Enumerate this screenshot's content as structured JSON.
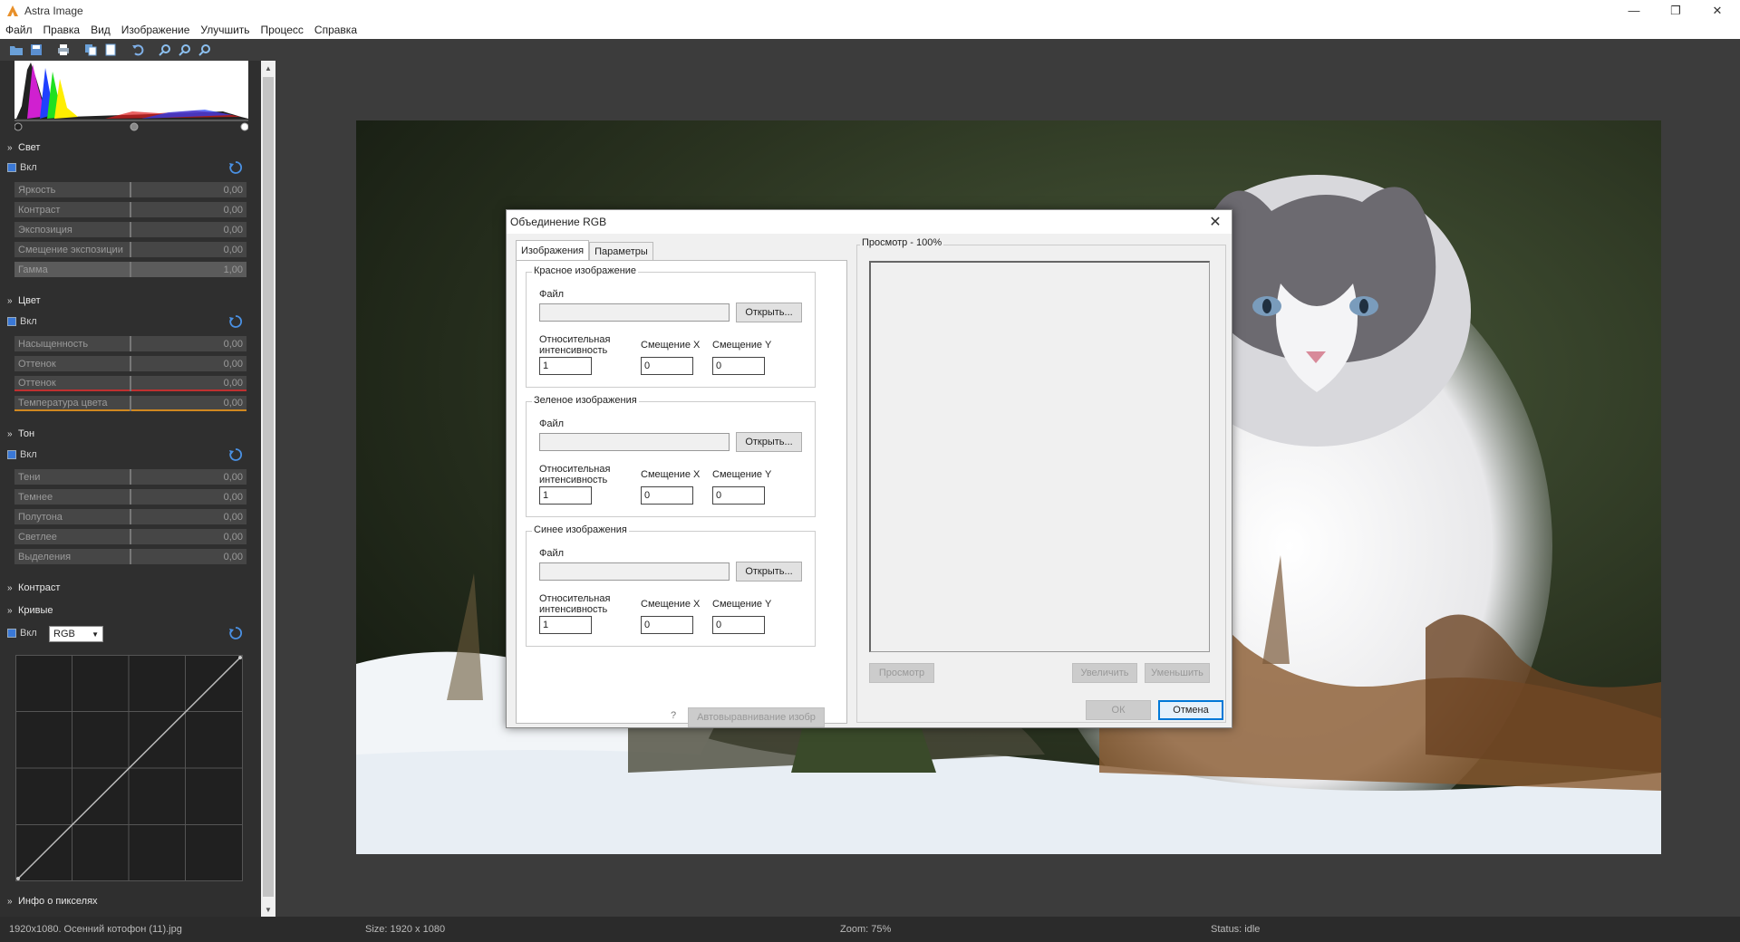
{
  "app": {
    "title": "Astra Image"
  },
  "window": {
    "minimize": "—",
    "restore": "❐",
    "close": "✕"
  },
  "menu": [
    "Файл",
    "Правка",
    "Вид",
    "Изображение",
    "Улучшить",
    "Процесс",
    "Справка"
  ],
  "panel": {
    "light": {
      "title": "Свет",
      "enable": "Вкл",
      "sliders": [
        {
          "label": "Яркость",
          "value": "0,00"
        },
        {
          "label": "Контраст",
          "value": "0,00"
        },
        {
          "label": "Экспозиция",
          "value": "0,00"
        },
        {
          "label": "Смещение экспозиции",
          "value": "0,00"
        },
        {
          "label": "Гамма",
          "value": "1,00"
        }
      ]
    },
    "color": {
      "title": "Цвет",
      "enable": "Вкл",
      "sliders": [
        {
          "label": "Насыщенность",
          "value": "0,00"
        },
        {
          "label": "Оттенок",
          "value": "0,00"
        },
        {
          "label": "Оттенок",
          "value": "0,00"
        },
        {
          "label": "Температура цвета",
          "value": "0,00"
        }
      ]
    },
    "tone": {
      "title": "Тон",
      "enable": "Вкл",
      "sliders": [
        {
          "label": "Тени",
          "value": "0,00"
        },
        {
          "label": "Темнее",
          "value": "0,00"
        },
        {
          "label": "Полутона",
          "value": "0,00"
        },
        {
          "label": "Светлее",
          "value": "0,00"
        },
        {
          "label": "Выделения",
          "value": "0,00"
        }
      ]
    },
    "contrast": {
      "title": "Контраст"
    },
    "curves": {
      "title": "Кривые",
      "enable": "Вкл",
      "channel": "RGB"
    },
    "pixelinfo": {
      "title": "Инфо о пикселях"
    }
  },
  "dialog": {
    "title": "Объединение RGB",
    "tabs": [
      "Изображения",
      "Параметры"
    ],
    "groups": [
      {
        "title": "Красное изображение",
        "file_label": "Файл",
        "open": "Открыть...",
        "intensity_label": "Относительная интенсивность",
        "offset_x_label": "Смещение X",
        "offset_y_label": "Смещение Y",
        "intensity": "1",
        "offset_x": "0",
        "offset_y": "0"
      },
      {
        "title": "Зеленое изображения",
        "file_label": "Файл",
        "open": "Открыть...",
        "intensity_label": "Относительная интенсивность",
        "offset_x_label": "Смещение X",
        "offset_y_label": "Смещение Y",
        "intensity": "1",
        "offset_x": "0",
        "offset_y": "0"
      },
      {
        "title": "Синее изображения",
        "file_label": "Файл",
        "open": "Открыть...",
        "intensity_label": "Относительная интенсивность",
        "offset_x_label": "Смещение X",
        "offset_y_label": "Смещение Y",
        "intensity": "1",
        "offset_x": "0",
        "offset_y": "0"
      }
    ],
    "autoalign": "Автовыравнивание изобр",
    "preview_label": "Просмотр - 100%",
    "preview_btn": "Просмотр",
    "zoom_in": "Увеличить",
    "zoom_out": "Уменьшить",
    "ok": "ОК",
    "cancel": "Отмена"
  },
  "status": {
    "file": "1920x1080. Осенний котофон (11).jpg",
    "size": "Size: 1920 x 1080",
    "zoom": "Zoom: 75%",
    "state": "Status: idle"
  }
}
